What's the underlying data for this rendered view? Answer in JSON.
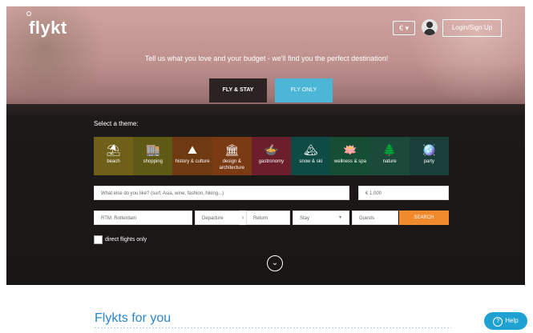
{
  "header": {
    "logo": "flykt",
    "lang": "€ ▾",
    "login": "Login/Sign Up"
  },
  "hero": {
    "tagline": "Tell us what you love and your budget - we'll find you the perfect destination!",
    "tabs": [
      {
        "label": "FLY & STAY"
      },
      {
        "label": "FLY ONLY"
      }
    ],
    "select_theme": "Select a theme:",
    "themes": [
      {
        "label": "beach",
        "icon": "beach-icon"
      },
      {
        "label": "shopping",
        "icon": "shopping-icon"
      },
      {
        "label": "history & culture",
        "icon": "history-icon"
      },
      {
        "label": "design & architecture",
        "icon": "architecture-icon"
      },
      {
        "label": "gastronomy",
        "icon": "food-icon"
      },
      {
        "label": "snow & ski",
        "icon": "ski-icon"
      },
      {
        "label": "wellness & spa",
        "icon": "spa-icon"
      },
      {
        "label": "nature",
        "icon": "tree-icon"
      },
      {
        "label": "party",
        "icon": "party-icon"
      }
    ],
    "inputs": {
      "likes_placeholder": "What else do you like? (surf, Asia, wine, fashion, hiking...)",
      "budget": "€ 1.000",
      "from": "RTM: Rotterdam",
      "departure": "Departure",
      "return": "Return",
      "stay": "Stay",
      "guests": "Guests",
      "search": "SEARCH"
    },
    "direct_flights_label": "direct flights only"
  },
  "main": {
    "section_title": "Flykts for you"
  },
  "help": {
    "label": "Help"
  }
}
